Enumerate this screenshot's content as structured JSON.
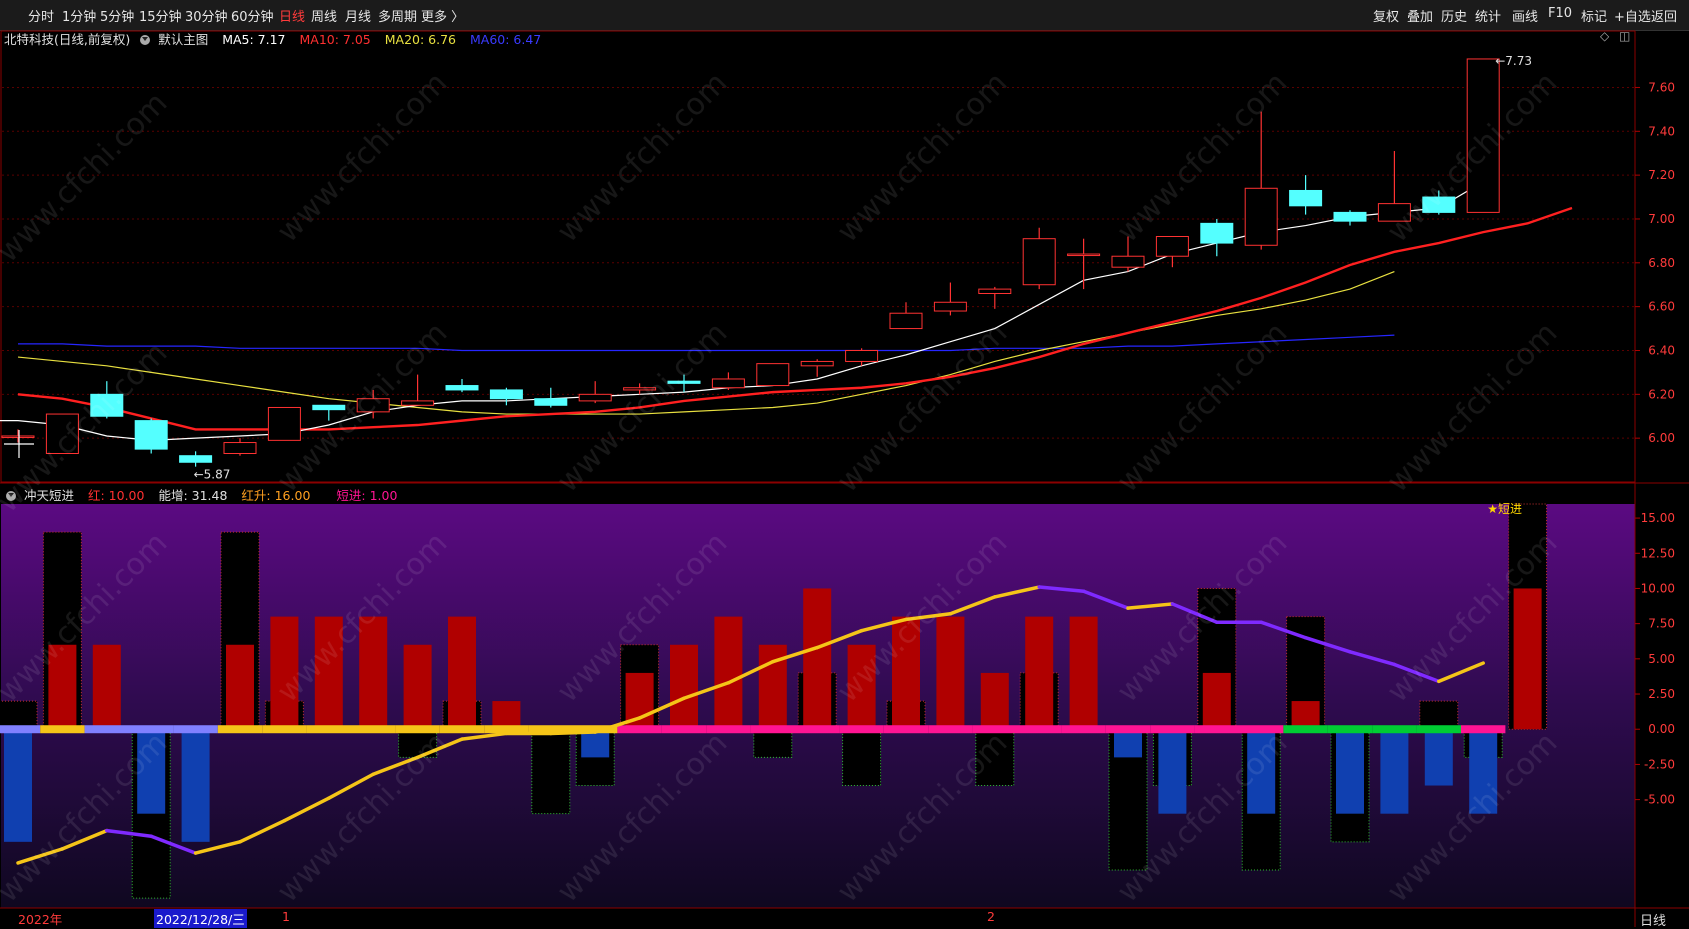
{
  "toolbar": {
    "left": [
      "分时",
      "1分钟",
      "5分钟",
      "15分钟",
      "30分钟",
      "60分钟",
      "日线",
      "周线",
      "月线",
      "多周期",
      "更多 〉"
    ],
    "active_index": 6,
    "right": [
      "复权",
      "叠加",
      "历史",
      "统计",
      "画线",
      "F10",
      "标记",
      "+自选",
      "返回"
    ]
  },
  "main_legend": {
    "stock": "北特科技(日线,前复权)",
    "panel": "默认主图",
    "ma5": "MA5: 7.17",
    "ma10": "MA10: 7.05",
    "ma20": "MA20: 6.76",
    "ma60": "MA60: 6.47"
  },
  "ind_legend": {
    "name": "冲天短进",
    "hong": "红: 10.00",
    "nengzeng": "能增: 31.48",
    "hongsheng": "红升: 16.00",
    "duanjin": "短进: 1.00"
  },
  "colors": {
    "up": "#ff3232",
    "down": "#54ffff",
    "ma5": "#ffffff",
    "ma10": "#ff2020",
    "ma20": "#e8e040",
    "ma60": "#2626ff",
    "red_bar": "#b00000",
    "blue_bar": "#1040b0",
    "gold": "#f5c518",
    "purple": "#7f2aff"
  },
  "watermark": "www.cfchi.com",
  "date_axis": {
    "year_label": "2022年",
    "cursor_label": "2022/12/28/三",
    "month_1": "1",
    "month_2": "2"
  },
  "bottom_right": "日线",
  "icons": [
    "diamond-icon",
    "restore-icon"
  ],
  "chart_data": [
    {
      "type": "candlestick",
      "name": "main",
      "y_ticks": [
        6.0,
        6.2,
        6.4,
        6.6,
        6.8,
        7.0,
        7.2,
        7.4,
        7.6
      ],
      "ylim": [
        5.8,
        7.78
      ],
      "annotations": [
        {
          "text": "5.87",
          "index": 4
        },
        {
          "text": "7.73",
          "index": 33
        }
      ],
      "candles": [
        {
          "o": 6.01,
          "h": 6.04,
          "l": 5.98,
          "c": 6.01
        },
        {
          "o": 5.93,
          "h": 6.11,
          "l": 5.93,
          "c": 6.11
        },
        {
          "o": 6.2,
          "h": 6.26,
          "l": 6.09,
          "c": 6.1
        },
        {
          "o": 6.08,
          "h": 6.09,
          "l": 5.93,
          "c": 5.95
        },
        {
          "o": 5.92,
          "h": 5.94,
          "l": 5.87,
          "c": 5.89
        },
        {
          "o": 5.93,
          "h": 6.0,
          "l": 5.92,
          "c": 5.98
        },
        {
          "o": 5.99,
          "h": 6.14,
          "l": 5.99,
          "c": 6.14
        },
        {
          "o": 6.15,
          "h": 6.15,
          "l": 6.08,
          "c": 6.13
        },
        {
          "o": 6.12,
          "h": 6.22,
          "l": 6.09,
          "c": 6.18
        },
        {
          "o": 6.15,
          "h": 6.29,
          "l": 6.15,
          "c": 6.17
        },
        {
          "o": 6.24,
          "h": 6.27,
          "l": 6.21,
          "c": 6.22
        },
        {
          "o": 6.22,
          "h": 6.23,
          "l": 6.15,
          "c": 6.18
        },
        {
          "o": 6.18,
          "h": 6.23,
          "l": 6.14,
          "c": 6.15
        },
        {
          "o": 6.17,
          "h": 6.26,
          "l": 6.16,
          "c": 6.2
        },
        {
          "o": 6.22,
          "h": 6.25,
          "l": 6.2,
          "c": 6.23
        },
        {
          "o": 6.26,
          "h": 6.29,
          "l": 6.21,
          "c": 6.25
        },
        {
          "o": 6.23,
          "h": 6.3,
          "l": 6.22,
          "c": 6.27
        },
        {
          "o": 6.24,
          "h": 6.34,
          "l": 6.24,
          "c": 6.34
        },
        {
          "o": 6.33,
          "h": 6.36,
          "l": 6.28,
          "c": 6.35
        },
        {
          "o": 6.35,
          "h": 6.41,
          "l": 6.33,
          "c": 6.4
        },
        {
          "o": 6.5,
          "h": 6.62,
          "l": 6.5,
          "c": 6.57
        },
        {
          "o": 6.58,
          "h": 6.71,
          "l": 6.56,
          "c": 6.62
        },
        {
          "o": 6.66,
          "h": 6.69,
          "l": 6.59,
          "c": 6.68
        },
        {
          "o": 6.7,
          "h": 6.96,
          "l": 6.68,
          "c": 6.91
        },
        {
          "o": 6.84,
          "h": 6.91,
          "l": 6.68,
          "c": 6.84
        },
        {
          "o": 6.78,
          "h": 6.92,
          "l": 6.76,
          "c": 6.83
        },
        {
          "o": 6.83,
          "h": 6.92,
          "l": 6.78,
          "c": 6.92
        },
        {
          "o": 6.98,
          "h": 7.0,
          "l": 6.83,
          "c": 6.89
        },
        {
          "o": 6.88,
          "h": 7.49,
          "l": 6.86,
          "c": 7.14
        },
        {
          "o": 7.13,
          "h": 7.2,
          "l": 7.02,
          "c": 7.06
        },
        {
          "o": 7.03,
          "h": 7.04,
          "l": 6.97,
          "c": 6.99
        },
        {
          "o": 6.99,
          "h": 7.31,
          "l": 6.99,
          "c": 7.07
        },
        {
          "o": 7.1,
          "h": 7.13,
          "l": 7.02,
          "c": 7.03
        },
        {
          "o": 7.03,
          "h": 7.73,
          "l": 7.03,
          "c": 7.73
        }
      ],
      "ma5": [
        6.08,
        6.08,
        6.06,
        6.01,
        5.99,
        6.0,
        6.01,
        6.02,
        6.06,
        6.12,
        6.15,
        6.17,
        6.17,
        6.18,
        6.19,
        6.2,
        6.21,
        6.23,
        6.24,
        6.27,
        6.33,
        6.38,
        6.44,
        6.5,
        6.61,
        6.72,
        6.76,
        6.84,
        6.89,
        6.94,
        6.97,
        7.01,
        7.03,
        7.05,
        7.17
      ],
      "ma10": [
        6.2,
        6.18,
        6.14,
        6.09,
        6.04,
        6.04,
        6.04,
        6.04,
        6.05,
        6.06,
        6.08,
        6.1,
        6.11,
        6.12,
        6.14,
        6.17,
        6.19,
        6.21,
        6.22,
        6.23,
        6.25,
        6.28,
        6.32,
        6.37,
        6.43,
        6.48,
        6.53,
        6.58,
        6.64,
        6.71,
        6.79,
        6.85,
        6.89,
        6.94,
        6.98,
        7.05
      ],
      "ma20": [
        6.37,
        6.35,
        6.33,
        6.3,
        6.27,
        6.24,
        6.21,
        6.18,
        6.16,
        6.14,
        6.12,
        6.11,
        6.11,
        6.11,
        6.11,
        6.12,
        6.13,
        6.14,
        6.16,
        6.2,
        6.24,
        6.29,
        6.35,
        6.4,
        6.44,
        6.48,
        6.52,
        6.56,
        6.59,
        6.63,
        6.68,
        6.76
      ],
      "ma60": [
        6.43,
        6.43,
        6.42,
        6.42,
        6.42,
        6.41,
        6.41,
        6.41,
        6.41,
        6.41,
        6.4,
        6.4,
        6.4,
        6.4,
        6.4,
        6.4,
        6.4,
        6.4,
        6.4,
        6.4,
        6.4,
        6.4,
        6.41,
        6.41,
        6.41,
        6.42,
        6.42,
        6.43,
        6.44,
        6.45,
        6.46,
        6.47
      ]
    },
    {
      "type": "indicator",
      "name": "冲天短进",
      "y_ticks": [
        -5.0,
        -2.5,
        0.0,
        2.5,
        5.0,
        7.5,
        10.0,
        12.5,
        15.0
      ],
      "ylim": [
        -12.7,
        16
      ],
      "top_label": "★短进",
      "red_bars": [
        0,
        6,
        6,
        0,
        0,
        6,
        8,
        8,
        8,
        6,
        8,
        2,
        0,
        0,
        4,
        6,
        8,
        6,
        10,
        6,
        8,
        8,
        4,
        8,
        8,
        0,
        0,
        4,
        0,
        2,
        0,
        0,
        0,
        0,
        10
      ],
      "blue_bars": [
        -8,
        0,
        0,
        -6,
        -8,
        0,
        0,
        0,
        0,
        0,
        0,
        0,
        0,
        -2,
        0,
        0,
        0,
        0,
        0,
        0,
        0,
        0,
        0,
        0,
        0,
        -2,
        -6,
        0,
        -6,
        0,
        -6,
        -6,
        -4,
        -6,
        0
      ],
      "outline_bars": [
        2,
        14,
        0,
        -12,
        0,
        14,
        2,
        0,
        0,
        -2,
        2,
        0,
        -6,
        -4,
        6,
        0,
        0,
        -2,
        4,
        -4,
        2,
        0,
        -4,
        4,
        0,
        -10,
        -4,
        10,
        -10,
        8,
        -8,
        0,
        2,
        -2,
        16
      ],
      "line": [
        -9.5,
        -8.5,
        -7.2,
        -7.6,
        -8.8,
        -8.0,
        -6.5,
        -4.9,
        -3.2,
        -2.0,
        -0.7,
        -0.3,
        -0.3,
        -0.2,
        0.8,
        2.2,
        3.3,
        4.8,
        5.8,
        7.0,
        7.8,
        8.2,
        9.4,
        10.1,
        9.8,
        8.6,
        8.9,
        7.6,
        7.6,
        6.5,
        5.5,
        4.6,
        3.4,
        4.7
      ],
      "line_colors": [
        "gold",
        "gold",
        "purple",
        "purple",
        "gold",
        "gold",
        "gold",
        "gold",
        "gold",
        "gold",
        "gold",
        "gold",
        "gold",
        "gold",
        "gold",
        "gold",
        "gold",
        "gold",
        "gold",
        "gold",
        "gold",
        "gold",
        "gold",
        "purple",
        "purple",
        "gold",
        "purple",
        "purple",
        "purple",
        "purple",
        "purple",
        "purple",
        "gold"
      ],
      "zero_band": [
        "#8080ff",
        "#f5c518",
        "#8080ff",
        "#8080ff",
        "#8080ff",
        "#f5c518",
        "#f5c518",
        "#f5c518",
        "#f5c518",
        "#f5c518",
        "#f5c518",
        "#f5c518",
        "#f5c518",
        "#f5c518",
        "#ff1493",
        "#ff1493",
        "#ff1493",
        "#ff1493",
        "#ff1493",
        "#ff1493",
        "#ff1493",
        "#ff1493",
        "#ff1493",
        "#ff1493",
        "#ff1493",
        "#ff1493",
        "#ff1493",
        "#ff1493",
        "#ff1493",
        "#00cc33",
        "#00cc33",
        "#00cc33",
        "#00cc33",
        "#ff1493"
      ]
    }
  ]
}
